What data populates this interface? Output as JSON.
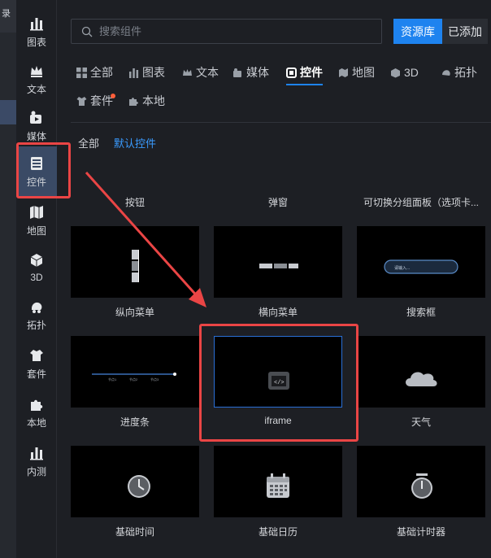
{
  "strip": {
    "glyph": "录"
  },
  "sidebar": {
    "items": [
      {
        "label": "图表",
        "icon": "chart-icon"
      },
      {
        "label": "文本",
        "icon": "text-crown-icon"
      },
      {
        "label": "媒体",
        "icon": "media-icon"
      },
      {
        "label": "控件",
        "icon": "widget-icon",
        "active": true
      },
      {
        "label": "地图",
        "icon": "map-icon"
      },
      {
        "label": "3D",
        "icon": "cube-icon"
      },
      {
        "label": "拓扑",
        "icon": "topology-icon"
      },
      {
        "label": "套件",
        "icon": "suit-icon"
      },
      {
        "label": "本地",
        "icon": "puzzle-icon"
      },
      {
        "label": "内测",
        "icon": "beta-chart-icon"
      }
    ]
  },
  "search": {
    "placeholder": "搜索组件",
    "value": ""
  },
  "header": {
    "library_label": "资源库",
    "added_label": "已添加"
  },
  "categories": [
    {
      "label": "全部",
      "icon": "grid-icon"
    },
    {
      "label": "图表",
      "icon": "chart-icon"
    },
    {
      "label": "文本",
      "icon": "text-crown-icon"
    },
    {
      "label": "媒体",
      "icon": "media-icon"
    },
    {
      "label": "控件",
      "icon": "widget-icon",
      "active": true
    },
    {
      "label": "地图",
      "icon": "map-icon"
    },
    {
      "label": "3D",
      "icon": "cube-icon"
    },
    {
      "label": "拓扑",
      "icon": "topology-icon"
    },
    {
      "label": "套件",
      "icon": "suit-icon",
      "badge": true
    },
    {
      "label": "本地",
      "icon": "puzzle-icon"
    }
  ],
  "subtabs": [
    {
      "label": "全部"
    },
    {
      "label": "默认控件",
      "active": true
    }
  ],
  "components": [
    {
      "label": "按钮",
      "preview": null
    },
    {
      "label": "弹窗",
      "preview": null
    },
    {
      "label": "可切换分组面板（选项卡...",
      "preview": null
    },
    {
      "label": "纵向菜单",
      "preview": "vertical-menu"
    },
    {
      "label": "横向菜单",
      "preview": "horizontal-menu"
    },
    {
      "label": "搜索框",
      "preview": "search-box",
      "preview_text": "请输入..."
    },
    {
      "label": "进度条",
      "preview": "progress",
      "preview_ticks": [
        "节点1",
        "节点2",
        "节点3"
      ]
    },
    {
      "label": "iframe",
      "preview": "iframe",
      "selected": true
    },
    {
      "label": "天气",
      "preview": "weather"
    },
    {
      "label": "基础时间",
      "preview": "clock"
    },
    {
      "label": "基础日历",
      "preview": "calendar"
    },
    {
      "label": "基础计时器",
      "preview": "timer"
    }
  ],
  "colors": {
    "accent": "#1e83ef",
    "annotation": "#ea4545",
    "badge": "#ff5e3a"
  }
}
